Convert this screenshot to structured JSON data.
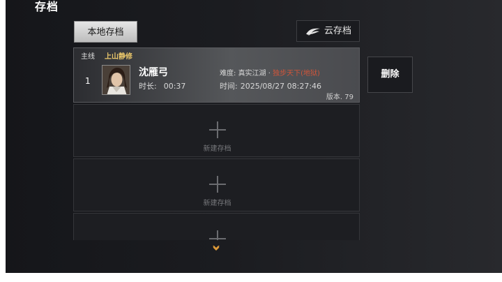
{
  "screen": {
    "title": "存档"
  },
  "tabs": {
    "local": "本地存档",
    "cloud": "云存档"
  },
  "save_slot": {
    "index": "1",
    "route": "主线",
    "chapter": "上山静修",
    "character_name": "沈雁弓",
    "play_time_label": "时长:",
    "play_time": "00:37",
    "difficulty_label": "难度:",
    "difficulty": "真实江湖 ·",
    "difficulty_mode": "独步天下(地狱)",
    "save_time_label": "时间:",
    "save_time": "2025/08/27 08:27:46",
    "version": "版本. 79"
  },
  "empty_slot_label": "新建存档",
  "delete_label": "删除",
  "colors": {
    "chapter": "#e9c66a",
    "hard_mode": "#d0553a",
    "background": "#1b1c20"
  },
  "icons": {
    "cloud": "wing-cloud-icon",
    "add": "plus-icon",
    "scroll": "chevron-down-icon"
  }
}
